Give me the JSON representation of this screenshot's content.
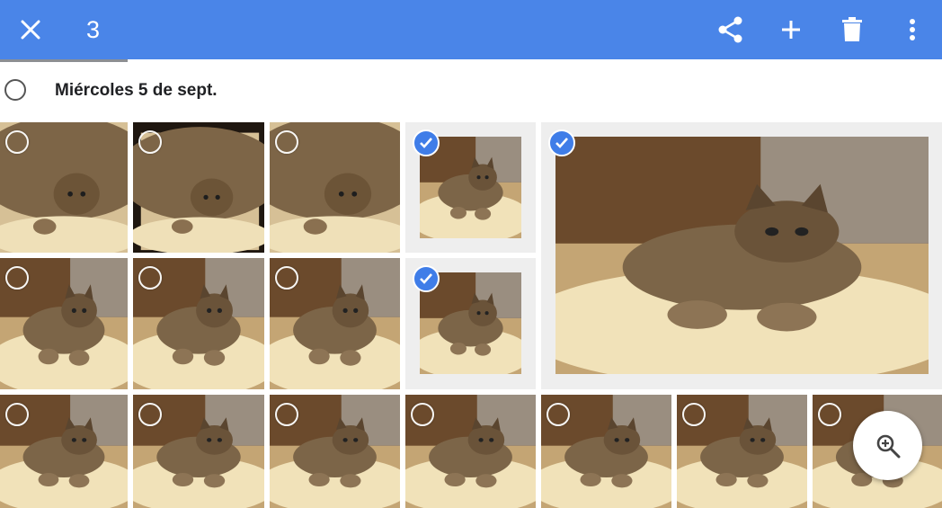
{
  "appbar": {
    "selected_count": "3",
    "close_icon": "close-icon",
    "share_icon": "share-icon",
    "add_icon": "add-icon",
    "delete_icon": "trash-icon",
    "more_icon": "more-vert-icon",
    "color": "#4a85e8"
  },
  "section": {
    "date_label": "Miércoles 5 de sept."
  },
  "photos": {
    "rows": 3,
    "total": 17,
    "selected_count": 3,
    "check_color": "#3f7de8"
  },
  "fab": {
    "icon": "zoom-in-icon"
  }
}
